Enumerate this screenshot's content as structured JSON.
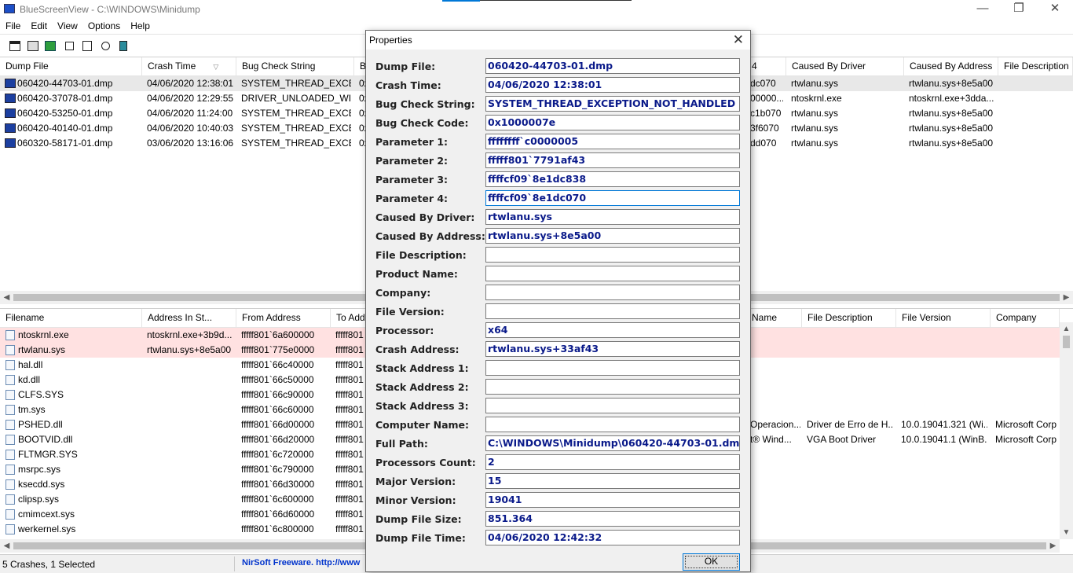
{
  "window": {
    "title": "BlueScreenView - C:\\WINDOWS\\Minidump",
    "minimize": "—",
    "restore": "❐",
    "close": "✕"
  },
  "menu": [
    "File",
    "Edit",
    "View",
    "Options",
    "Help"
  ],
  "toolbar": {
    "icons": [
      "properties-icon",
      "save-icon",
      "refresh-icon",
      "copy-icon",
      "options-icon",
      "find-icon",
      "exit-icon"
    ]
  },
  "top_table": {
    "left_headers": [
      "Dump File",
      "Crash Time",
      "Bug Check String",
      "B"
    ],
    "sort_indicator": "▽",
    "right_headers": [
      "4",
      "Caused By Driver",
      "Caused By Address",
      "File Description"
    ],
    "rows": [
      {
        "dump": "060420-44703-01.dmp",
        "time": "04/06/2020 12:38:01",
        "bug": "SYSTEM_THREAD_EXCE...",
        "b": "0x",
        "p4": "dc070",
        "driver": "rtwlanu.sys",
        "address": "rtwlanu.sys+8e5a00"
      },
      {
        "dump": "060420-37078-01.dmp",
        "time": "04/06/2020 12:29:55",
        "bug": "DRIVER_UNLOADED_WI...",
        "b": "0x",
        "p4": "00000...",
        "driver": "ntoskrnl.exe",
        "address": "ntoskrnl.exe+3dda..."
      },
      {
        "dump": "060420-53250-01.dmp",
        "time": "04/06/2020 11:24:00",
        "bug": "SYSTEM_THREAD_EXCE...",
        "b": "0x",
        "p4": "c1b070",
        "driver": "rtwlanu.sys",
        "address": "rtwlanu.sys+8e5a00"
      },
      {
        "dump": "060420-40140-01.dmp",
        "time": "04/06/2020 10:40:03",
        "bug": "SYSTEM_THREAD_EXCE...",
        "b": "0x",
        "p4": "3f6070",
        "driver": "rtwlanu.sys",
        "address": "rtwlanu.sys+8e5a00"
      },
      {
        "dump": "060320-58171-01.dmp",
        "time": "03/06/2020 13:16:06",
        "bug": "SYSTEM_THREAD_EXCE...",
        "b": "0x",
        "p4": "dd070",
        "driver": "rtwlanu.sys",
        "address": "rtwlanu.sys+8e5a00"
      }
    ]
  },
  "bottom_table": {
    "left_headers": [
      "Filename",
      "Address In St...",
      "From Address",
      "To Addr"
    ],
    "right_headers": [
      "Name",
      "File Description",
      "File Version",
      "Company"
    ],
    "rows": [
      {
        "file": "ntoskrnl.exe",
        "addr": "ntoskrnl.exe+3b9d...",
        "from": "fffff801`6a600000",
        "to": "fffff801",
        "name": "",
        "desc": "",
        "ver": "",
        "company": ""
      },
      {
        "file": "rtwlanu.sys",
        "addr": "rtwlanu.sys+8e5a00",
        "from": "fffff801`775e0000",
        "to": "fffff801",
        "name": "",
        "desc": "",
        "ver": "",
        "company": ""
      },
      {
        "file": "hal.dll",
        "addr": "",
        "from": "fffff801`66c40000",
        "to": "fffff801",
        "name": "",
        "desc": "",
        "ver": "",
        "company": ""
      },
      {
        "file": "kd.dll",
        "addr": "",
        "from": "fffff801`66c50000",
        "to": "fffff801",
        "name": "",
        "desc": "",
        "ver": "",
        "company": ""
      },
      {
        "file": "CLFS.SYS",
        "addr": "",
        "from": "fffff801`66c90000",
        "to": "fffff801",
        "name": "",
        "desc": "",
        "ver": "",
        "company": ""
      },
      {
        "file": "tm.sys",
        "addr": "",
        "from": "fffff801`66c60000",
        "to": "fffff801",
        "name": "",
        "desc": "",
        "ver": "",
        "company": ""
      },
      {
        "file": "PSHED.dll",
        "addr": "",
        "from": "fffff801`66d00000",
        "to": "fffff801",
        "name": "Operacion...",
        "desc": "Driver de Erro de H...",
        "ver": "10.0.19041.321 (Wi...",
        "company": "Microsoft Corp"
      },
      {
        "file": "BOOTVID.dll",
        "addr": "",
        "from": "fffff801`66d20000",
        "to": "fffff801",
        "name": "t® Wind...",
        "desc": "VGA Boot Driver",
        "ver": "10.0.19041.1 (WinB...",
        "company": "Microsoft Corp"
      },
      {
        "file": "FLTMGR.SYS",
        "addr": "",
        "from": "fffff801`6c720000",
        "to": "fffff801",
        "name": "",
        "desc": "",
        "ver": "",
        "company": ""
      },
      {
        "file": "msrpc.sys",
        "addr": "",
        "from": "fffff801`6c790000",
        "to": "fffff801",
        "name": "",
        "desc": "",
        "ver": "",
        "company": ""
      },
      {
        "file": "ksecdd.sys",
        "addr": "",
        "from": "fffff801`66d30000",
        "to": "fffff801",
        "name": "",
        "desc": "",
        "ver": "",
        "company": ""
      },
      {
        "file": "clipsp.sys",
        "addr": "",
        "from": "fffff801`6c600000",
        "to": "fffff801",
        "name": "",
        "desc": "",
        "ver": "",
        "company": ""
      },
      {
        "file": "cmimcext.sys",
        "addr": "",
        "from": "fffff801`66d60000",
        "to": "fffff801",
        "name": "",
        "desc": "",
        "ver": "",
        "company": ""
      },
      {
        "file": "werkernel.sys",
        "addr": "",
        "from": "fffff801`6c800000",
        "to": "fffff801",
        "name": "",
        "desc": "",
        "ver": "",
        "company": ""
      }
    ]
  },
  "statusbar": {
    "summary": "5 Crashes, 1 Selected",
    "link": "NirSoft Freeware.  http://www"
  },
  "dialog": {
    "title": "Properties",
    "close": "✕",
    "ok_label": "OK",
    "fields": [
      {
        "label": "Dump File:",
        "value": "060420-44703-01.dmp"
      },
      {
        "label": "Crash Time:",
        "value": "04/06/2020 12:38:01"
      },
      {
        "label": "Bug Check String:",
        "value": "SYSTEM_THREAD_EXCEPTION_NOT_HANDLED"
      },
      {
        "label": "Bug Check Code:",
        "value": "0x1000007e"
      },
      {
        "label": "Parameter 1:",
        "value": "ffffffff`c0000005"
      },
      {
        "label": "Parameter 2:",
        "value": "fffff801`7791af43"
      },
      {
        "label": "Parameter 3:",
        "value": "ffffcf09`8e1dc838"
      },
      {
        "label": "Parameter 4:",
        "value": "ffffcf09`8e1dc070"
      },
      {
        "label": "Caused By Driver:",
        "value": "rtwlanu.sys"
      },
      {
        "label": "Caused By Address:",
        "value": "rtwlanu.sys+8e5a00"
      },
      {
        "label": "File Description:",
        "value": ""
      },
      {
        "label": "Product Name:",
        "value": ""
      },
      {
        "label": "Company:",
        "value": ""
      },
      {
        "label": "File Version:",
        "value": ""
      },
      {
        "label": "Processor:",
        "value": "x64"
      },
      {
        "label": "Crash Address:",
        "value": "rtwlanu.sys+33af43"
      },
      {
        "label": "Stack Address 1:",
        "value": ""
      },
      {
        "label": "Stack Address 2:",
        "value": ""
      },
      {
        "label": "Stack Address 3:",
        "value": ""
      },
      {
        "label": "Computer Name:",
        "value": ""
      },
      {
        "label": "Full Path:",
        "value": "C:\\WINDOWS\\Minidump\\060420-44703-01.dmp"
      },
      {
        "label": "Processors Count:",
        "value": "2"
      },
      {
        "label": "Major Version:",
        "value": "15"
      },
      {
        "label": "Minor Version:",
        "value": "19041"
      },
      {
        "label": "Dump File Size:",
        "value": "851.364"
      },
      {
        "label": "Dump File Time:",
        "value": "04/06/2020 12:42:32"
      }
    ]
  }
}
